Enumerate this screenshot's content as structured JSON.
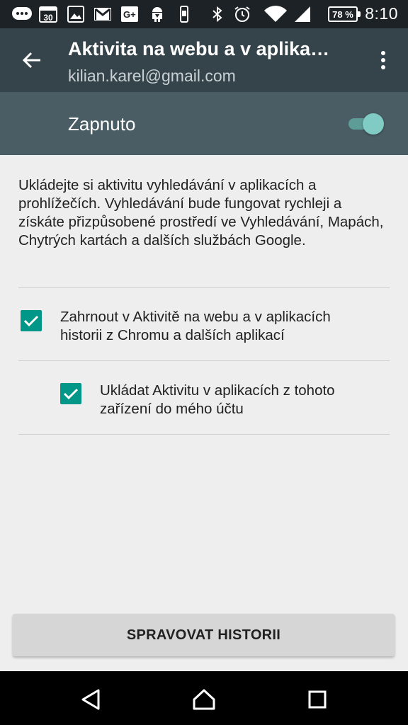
{
  "status_bar": {
    "time": "8:10",
    "battery": "78 %",
    "calendar_day": "30",
    "icons": [
      "messages-icon",
      "calendar-icon",
      "gallery-icon",
      "gmail-icon",
      "google-plus-icon",
      "android-download-icon",
      "device-update-icon",
      "bluetooth-icon",
      "alarm-icon",
      "wifi-icon",
      "cellular-signal-icon",
      "battery-icon"
    ]
  },
  "app_bar": {
    "title": "Aktivita na webu a v aplika…",
    "subtitle": "kilian.karel@gmail.com",
    "back_icon": "arrow-back-icon",
    "menu_icon": "more-vert-icon"
  },
  "toggle": {
    "label": "Zapnuto",
    "state": "on"
  },
  "description": "Ukládejte si aktivitu vyhledávání v aplikacích a prohlížečích. Vyhledávání bude fungovat rychleji a získáte přizpůsobené prostředí ve Vyhledávání, Mapách, Chytrých kartách a dalších službách Google.",
  "options": [
    {
      "label": "Zahrnout v Aktivitě na webu a v aplikacích historii z Chromu a dalších aplikací",
      "checked": true
    },
    {
      "label": "Ukládat Aktivitu v aplikacích z tohoto zařízení do mého účtu",
      "checked": true
    }
  ],
  "manage_button": "SPRAVOVAT HISTORII",
  "nav_bar": {
    "icons": [
      "back-triangle-icon",
      "home-icon",
      "recents-icon"
    ]
  },
  "colors": {
    "status_bar": "#1c2225",
    "app_bar": "#35444b",
    "toggle_bar": "#4a5d65",
    "accent": "#009688",
    "switch_thumb": "#80cbc4",
    "background": "#eeeeee"
  }
}
